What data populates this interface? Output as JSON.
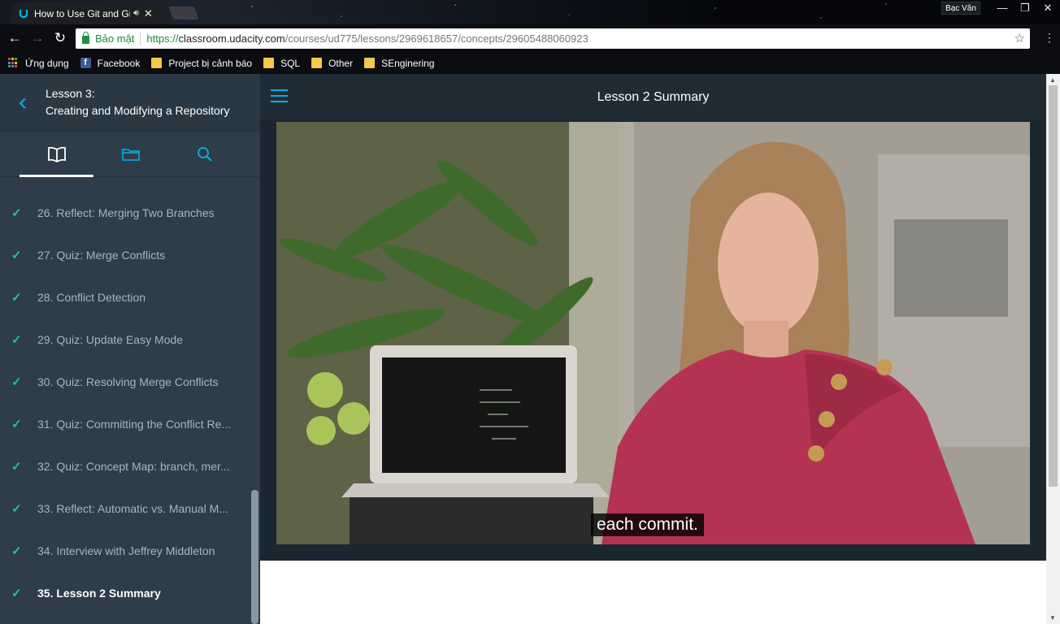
{
  "browser": {
    "tab_title": "How to Use Git and GitHub",
    "tab_audio_icon": "speaker-icon",
    "profile_name": "Bạc Vân",
    "window_controls": [
      "minimize",
      "restore",
      "close"
    ],
    "security_label": "Bảo mật",
    "url_protocol": "https://",
    "url_host": "classroom.udacity.com",
    "url_path": "/courses/ud775/lessons/2969618657/concepts/29605488060923",
    "bookmarks": [
      {
        "label": "Ứng dụng",
        "icon": "apps-grid-icon"
      },
      {
        "label": "Facebook",
        "icon": "facebook-icon"
      },
      {
        "label": "Project bị cảnh báo",
        "icon": "folder-icon"
      },
      {
        "label": "SQL",
        "icon": "folder-icon"
      },
      {
        "label": "Other",
        "icon": "folder-icon"
      },
      {
        "label": "SEnginering",
        "icon": "folder-icon"
      }
    ]
  },
  "sidebar": {
    "lesson_number": "Lesson 3:",
    "lesson_name": "Creating and Modifying a Repository",
    "tabs": [
      "book-icon",
      "folder-icon",
      "search-icon"
    ],
    "concepts": [
      {
        "label": "26. Reflect: Merging Two Branches",
        "done": true
      },
      {
        "label": "27. Quiz: Merge Conflicts",
        "done": true
      },
      {
        "label": "28. Conflict Detection",
        "done": true
      },
      {
        "label": "29. Quiz: Update Easy Mode",
        "done": true
      },
      {
        "label": "30. Quiz: Resolving Merge Conflicts",
        "done": true
      },
      {
        "label": "31. Quiz: Committing the Conflict Re...",
        "done": true
      },
      {
        "label": "32. Quiz: Concept Map: branch, mer...",
        "done": true
      },
      {
        "label": "33. Reflect: Automatic vs. Manual M...",
        "done": true
      },
      {
        "label": "34. Interview with Jeffrey Middleton",
        "done": true
      },
      {
        "label": "35. Lesson 2 Summary",
        "done": true,
        "current": true
      }
    ]
  },
  "main": {
    "title": "Lesson 2 Summary",
    "video_caption": "each commit."
  },
  "colors": {
    "accent": "#02b3e4",
    "sidebar_bg": "#2e3d49",
    "check": "#1fc1a9"
  }
}
